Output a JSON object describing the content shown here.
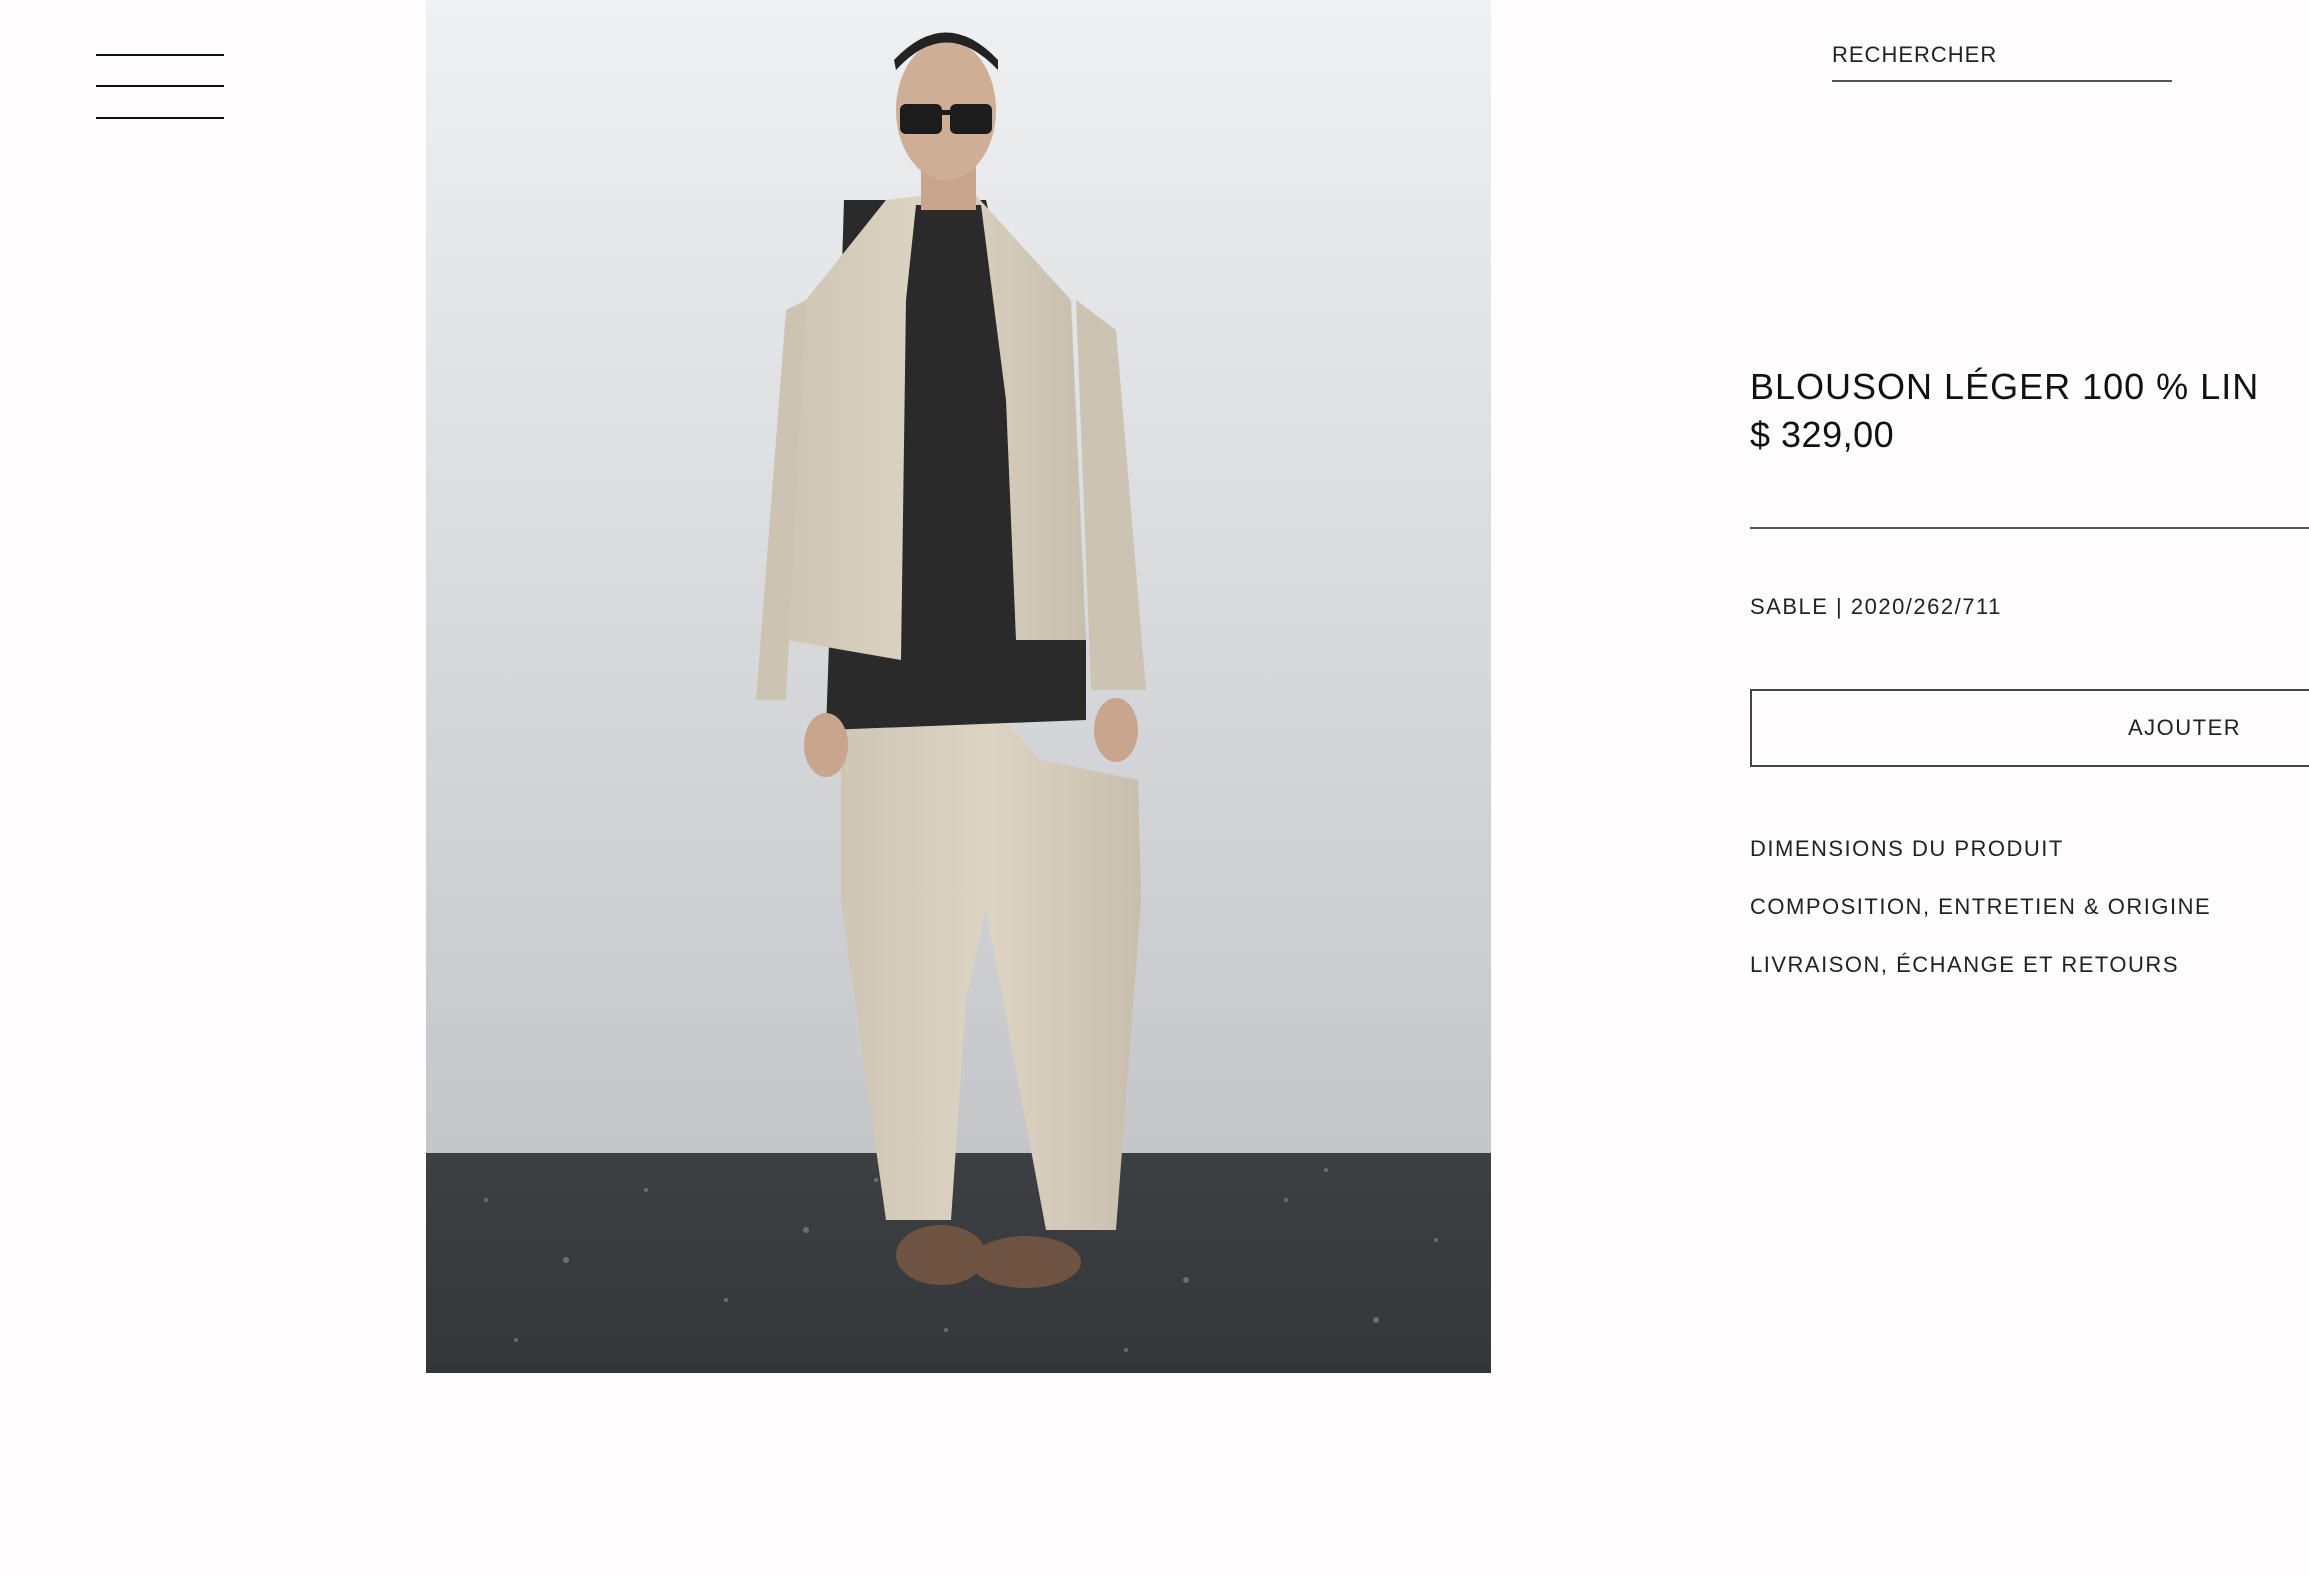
{
  "header": {
    "menu_icon": "hamburger-menu-icon",
    "search_label": "RECHERCHER"
  },
  "product": {
    "image_alt": "Mannequin portant un blouson léger en lin couleur sable",
    "title": "BLOUSON LÉGER 100 % LIN",
    "price": "$ 329,00",
    "variant": "SABLE | 2020/262/711",
    "add_button_label": "AJOUTER",
    "info_links": [
      "DIMENSIONS DU PRODUIT",
      "COMPOSITION, ENTRETIEN & ORIGINE",
      "LIVRAISON, ÉCHANGE ET RETOURS"
    ]
  },
  "colors": {
    "background": "#fffdfd",
    "text": "#1a1a1a",
    "jacket": "#d8cfc0",
    "floor": "#3a3d40"
  }
}
